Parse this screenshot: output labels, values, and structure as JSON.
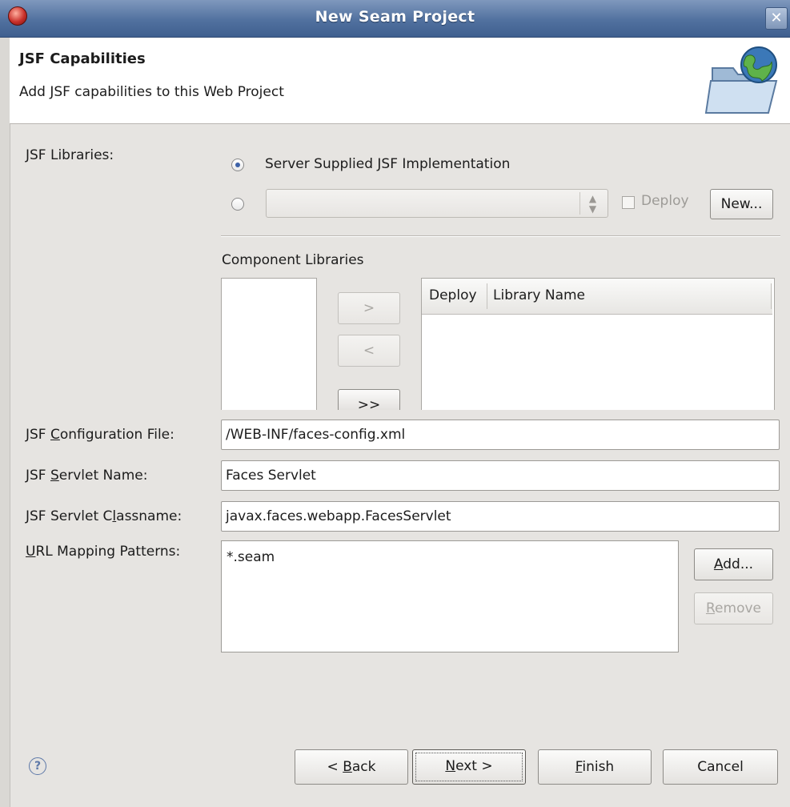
{
  "window": {
    "title": "New Seam Project",
    "close_glyph": "✕",
    "app_icon": "eclipse-icon"
  },
  "banner": {
    "title": "JSF Capabilities",
    "description": "Add JSF capabilities to this Web Project",
    "icon": "folder-globe-icon"
  },
  "jsf_libraries": {
    "label": "JSF Libraries:",
    "option_server_supplied": "Server Supplied JSF Implementation",
    "option_server_supplied_selected": true,
    "option_custom_selected": false,
    "custom_library_value": "",
    "deploy_label": "Deploy",
    "deploy_checked": false,
    "new_button": "New..."
  },
  "component_libraries": {
    "label": "Component Libraries",
    "available": [],
    "add_button": ">",
    "remove_button": "<",
    "add_all_button": ">>",
    "columns": [
      "Deploy",
      "Library Name"
    ],
    "rows": []
  },
  "form": {
    "config_file_label_pre": "JSF ",
    "config_file_label_mnemonic": "C",
    "config_file_label_post": "onfiguration File:",
    "config_file_value": "/WEB-INF/faces-config.xml",
    "servlet_name_label_pre": "JSF ",
    "servlet_name_label_mnemonic": "S",
    "servlet_name_label_post": "ervlet Name:",
    "servlet_name_value": "Faces Servlet",
    "servlet_class_label_pre": "JSF Servlet C",
    "servlet_class_label_mnemonic": "l",
    "servlet_class_label_post": "assname:",
    "servlet_class_value": "javax.faces.webapp.FacesServlet",
    "url_mapping_label_mnemonic": "U",
    "url_mapping_label_post": "RL Mapping Patterns:",
    "url_patterns": [
      "*.seam"
    ],
    "add_button_mnemonic": "A",
    "add_button_post": "dd...",
    "remove_button_mnemonic": "R",
    "remove_button_post": "emove"
  },
  "footer": {
    "help_glyph": "?",
    "back_pre": "< ",
    "back_mnemonic": "B",
    "back_post": "ack",
    "next_mnemonic": "N",
    "next_post": "ext >",
    "finish_mnemonic": "F",
    "finish_post": "inish",
    "cancel": "Cancel"
  }
}
